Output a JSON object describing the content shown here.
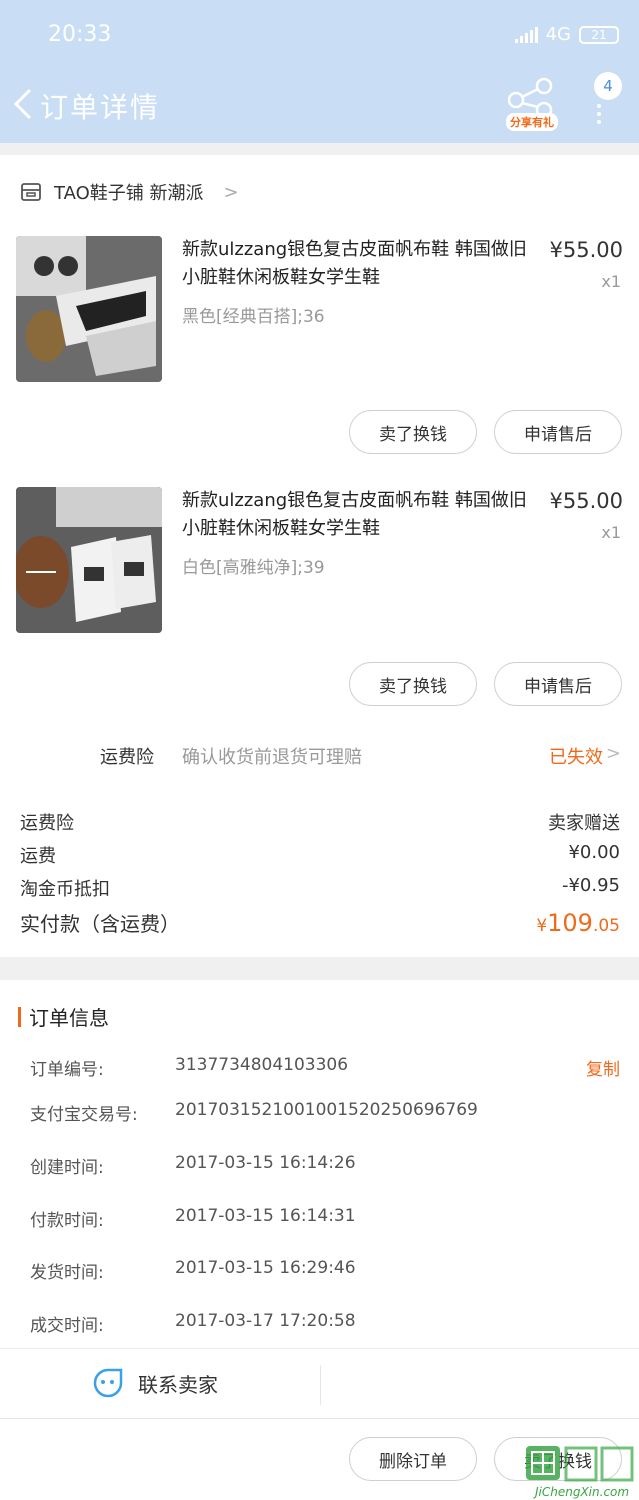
{
  "status_bar": {
    "time": "20:33",
    "network": "4G",
    "battery": "21"
  },
  "header": {
    "title": "订单详情",
    "share_tag": "分享有礼",
    "badge": "4"
  },
  "shop": {
    "name": "TAO鞋子铺 新潮派"
  },
  "products": [
    {
      "title": "新款ulzzang银色复古皮面帆布鞋 韩国做旧小脏鞋休闲板鞋女学生鞋",
      "sku": "黑色[经典百搭];36",
      "price": "¥55.00",
      "qty": "x1",
      "btn_sell": "卖了换钱",
      "btn_aftersale": "申请售后"
    },
    {
      "title": "新款ulzzang银色复古皮面帆布鞋 韩国做旧小脏鞋休闲板鞋女学生鞋",
      "sku": "白色[高雅纯净];39",
      "price": "¥55.00",
      "qty": "x1",
      "btn_sell": "卖了换钱",
      "btn_aftersale": "申请售后"
    }
  ],
  "insurance": {
    "label": "运费险",
    "desc": "确认收货前退货可理赔",
    "status": "已失效"
  },
  "fees": [
    {
      "label": "运费险",
      "value": "卖家赠送"
    },
    {
      "label": "运费",
      "value": "¥0.00"
    },
    {
      "label": "淘金币抵扣",
      "value": "-¥0.95"
    }
  ],
  "total": {
    "label": "实付款（含运费）",
    "currency": "¥",
    "integer": "109",
    "decimal": ".05"
  },
  "order_info": {
    "title": "订单信息",
    "copy_label": "复制",
    "rows": [
      {
        "label": "订单编号:",
        "value": "3137734804103306"
      },
      {
        "label": "支付宝交易号:",
        "value": "2017031521001001520250696769"
      },
      {
        "label": "创建时间:",
        "value": "2017-03-15 16:14:26"
      },
      {
        "label": "付款时间:",
        "value": "2017-03-15 16:14:31"
      },
      {
        "label": "发货时间:",
        "value": "2017-03-15 16:29:46"
      },
      {
        "label": "成交时间:",
        "value": "2017-03-17 17:20:58"
      }
    ]
  },
  "contact": {
    "label": "联系卖家"
  },
  "bottom_bar": {
    "delete_label": "删除订单",
    "sell_label": "卖了换钱"
  },
  "watermark": {
    "text": "JiChengXin.com"
  },
  "colors": {
    "header_bg": "#c9ddf5",
    "accent": "#f06a1a",
    "contact_icon": "#3aa0e8"
  }
}
